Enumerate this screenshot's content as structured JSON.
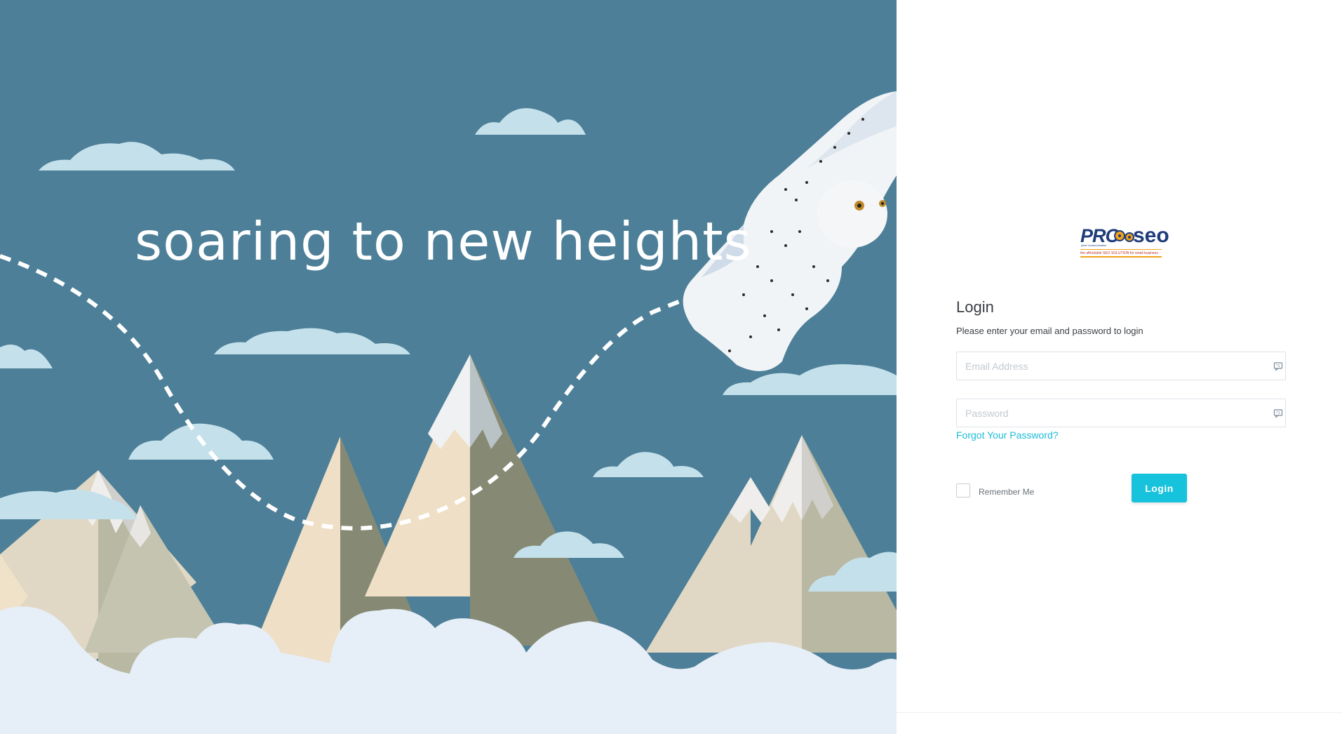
{
  "hero": {
    "tagline": "soaring to new heights"
  },
  "logo": {
    "brand_left": "PRO",
    "brand_right": "seo",
    "subtext": "pixel communication",
    "tagline": "the affordable SEO SOLUTION for small business"
  },
  "login": {
    "title": "Login",
    "subtitle": "Please enter your email and password to login",
    "email_placeholder": "Email Address",
    "password_placeholder": "Password",
    "forgot_label": "Forgot Your Password?",
    "remember_label": "Remember Me",
    "submit_label": "Login"
  },
  "colors": {
    "sky": "#4d7f98",
    "accent": "#16c2dc",
    "link": "#1bbcd8",
    "brand_blue": "#1f3c7a",
    "brand_orange": "#f2a21b"
  },
  "icons": {
    "field_icon": "password-manager-icon"
  }
}
